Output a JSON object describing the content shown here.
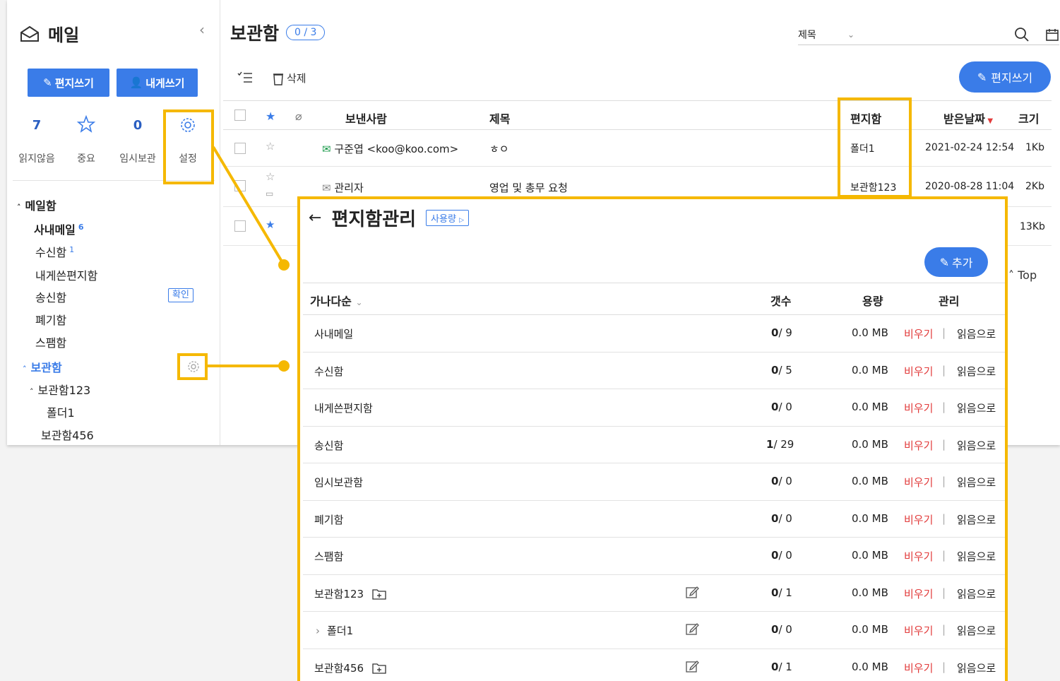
{
  "sidebar": {
    "title": "메일",
    "compose_label": "편지쓰기",
    "self_compose_label": "내게쓰기",
    "stats": [
      {
        "value": "7",
        "label": "읽지않음"
      },
      {
        "icon": "star-icon",
        "label": "중요"
      },
      {
        "value": "0",
        "label": "임시보관"
      },
      {
        "icon": "gear-icon",
        "label": "설정"
      }
    ],
    "mailbox_header": "메일함",
    "items": [
      {
        "label": "사내메일",
        "count": "6"
      },
      {
        "label": "수신함",
        "count": "1"
      },
      {
        "label": "내게쓴편지함"
      },
      {
        "label": "송신함",
        "badge": "확인"
      },
      {
        "label": "폐기함"
      },
      {
        "label": "스팸함"
      }
    ],
    "storage_header": "보관함",
    "storage_items": [
      {
        "label": "보관함123"
      },
      {
        "label": "폴더1"
      },
      {
        "label": "보관함456"
      }
    ]
  },
  "content": {
    "title": "보관함",
    "count": "0 / 3",
    "search_field": "제목",
    "toolbar": {
      "delete_label": "삭제",
      "compose_label": "편지쓰기"
    },
    "columns": {
      "sender": "보낸사람",
      "subject": "제목",
      "folder": "편지함",
      "date": "받은날짜",
      "size": "크기"
    },
    "rows": [
      {
        "sender": "구준엽 <koo@koo.com>",
        "subject": "ㅎㅇ",
        "folder": "폴더1",
        "date": "2021-02-24 12:54",
        "size": "1Kb"
      },
      {
        "sender": "관리자",
        "subject": "영업 및 총무 요청",
        "folder": "보관함123",
        "date": "2020-08-28 11:04",
        "size": "2Kb"
      },
      {
        "size": "13Kb"
      }
    ],
    "top_link": "Top"
  },
  "modal": {
    "title": "편지함관리",
    "usage_label": "사용량",
    "add_label": "추가",
    "sort_label": "가나다순",
    "col_count": "갯수",
    "col_size": "용량",
    "col_manage": "관리",
    "empty_label": "비우기",
    "read_label": "읽음으로",
    "rows": [
      {
        "name": "사내메일",
        "unread": "0",
        "total": "/ 9",
        "size": "0.0 MB"
      },
      {
        "name": "수신함",
        "unread": "0",
        "total": "/ 5",
        "size": "0.0 MB"
      },
      {
        "name": "내게쓴편지함",
        "unread": "0",
        "total": "/ 0",
        "size": "0.0 MB"
      },
      {
        "name": "송신함",
        "unread": "1",
        "total": "/ 29",
        "size": "0.0 MB"
      },
      {
        "name": "임시보관함",
        "unread": "0",
        "total": "/ 0",
        "size": "0.0 MB"
      },
      {
        "name": "폐기함",
        "unread": "0",
        "total": "/ 0",
        "size": "0.0 MB"
      },
      {
        "name": "스팸함",
        "unread": "0",
        "total": "/ 0",
        "size": "0.0 MB"
      },
      {
        "name": "보관함123",
        "unread": "0",
        "total": "/ 1",
        "size": "0.0 MB",
        "editable": true,
        "addfolder": true
      },
      {
        "name": "폴더1",
        "unread": "0",
        "total": "/ 0",
        "size": "0.0 MB",
        "editable": true,
        "sub": true
      },
      {
        "name": "보관함456",
        "unread": "0",
        "total": "/ 1",
        "size": "0.0 MB",
        "editable": true,
        "addfolder": true
      }
    ]
  },
  "colors": {
    "accent": "#3a7ce8",
    "highlight": "#f5b800",
    "danger": "#e23b3b"
  }
}
